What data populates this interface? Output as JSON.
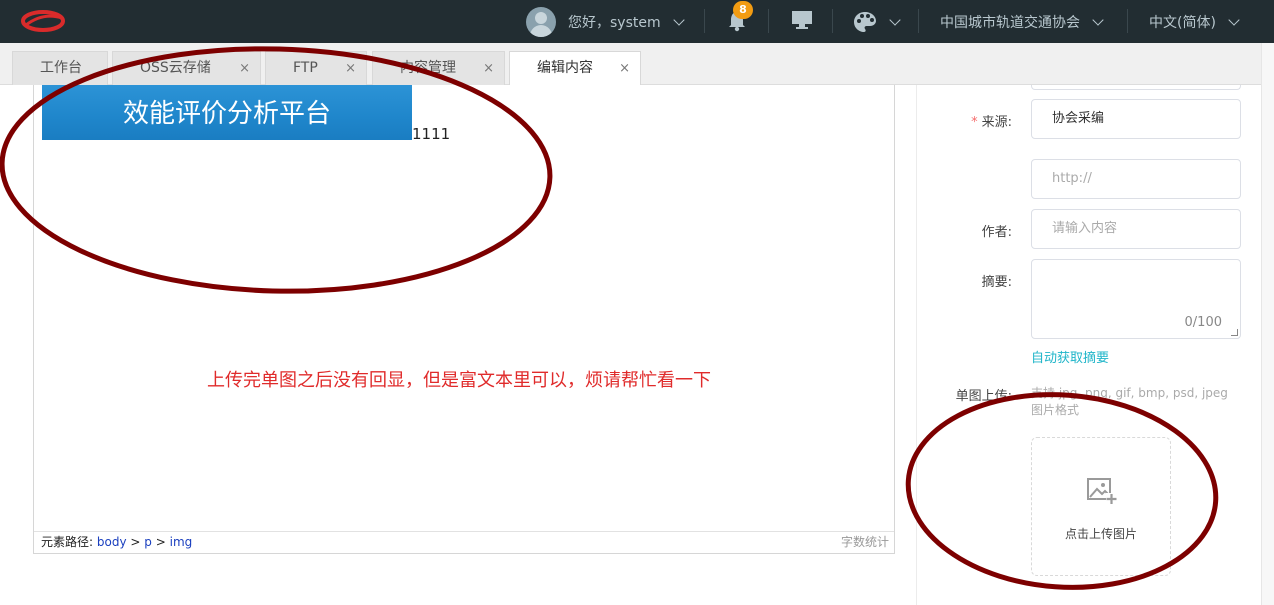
{
  "header": {
    "greeting": "您好，system",
    "notification_count": "8",
    "organization": "中国城市轨道交通协会",
    "language": "中文(简体)"
  },
  "tabs": [
    {
      "label": "工作台",
      "closable": false
    },
    {
      "label": "OSS云存储",
      "closable": true
    },
    {
      "label": "FTP",
      "closable": true
    },
    {
      "label": "内容管理",
      "closable": true
    },
    {
      "label": "编辑内容",
      "closable": true,
      "active": true
    }
  ],
  "tab_close_glyph": "×",
  "editor": {
    "image_title": "效能评价分析平台",
    "text_after_image": "1111",
    "element_path_label": "元素路径:",
    "element_path": [
      "body",
      "p",
      "img"
    ],
    "path_separator": ">",
    "word_count_label": "字数统计",
    "annotation_note": "上传完单图之后没有回显，但是富文本里可以，烦请帮忙看一下"
  },
  "form": {
    "source_label": "来源:",
    "source_value": "协会采编",
    "url_placeholder": "http://",
    "author_label": "作者:",
    "author_placeholder": "请输入内容",
    "summary_label": "摘要:",
    "summary_count": "0/100",
    "auto_summary_link": "自动获取摘要",
    "single_image_label": "单图上传:",
    "single_image_hint": "支持 jpg, png, gif, bmp, psd, jpeg 图片格式",
    "upload_caption": "点击上传图片"
  },
  "colors": {
    "topbar": "#222d32",
    "badge": "#f39c12",
    "link": "#1fb5c9",
    "annotation": "#7d0000",
    "note_text": "#e02b2b"
  }
}
